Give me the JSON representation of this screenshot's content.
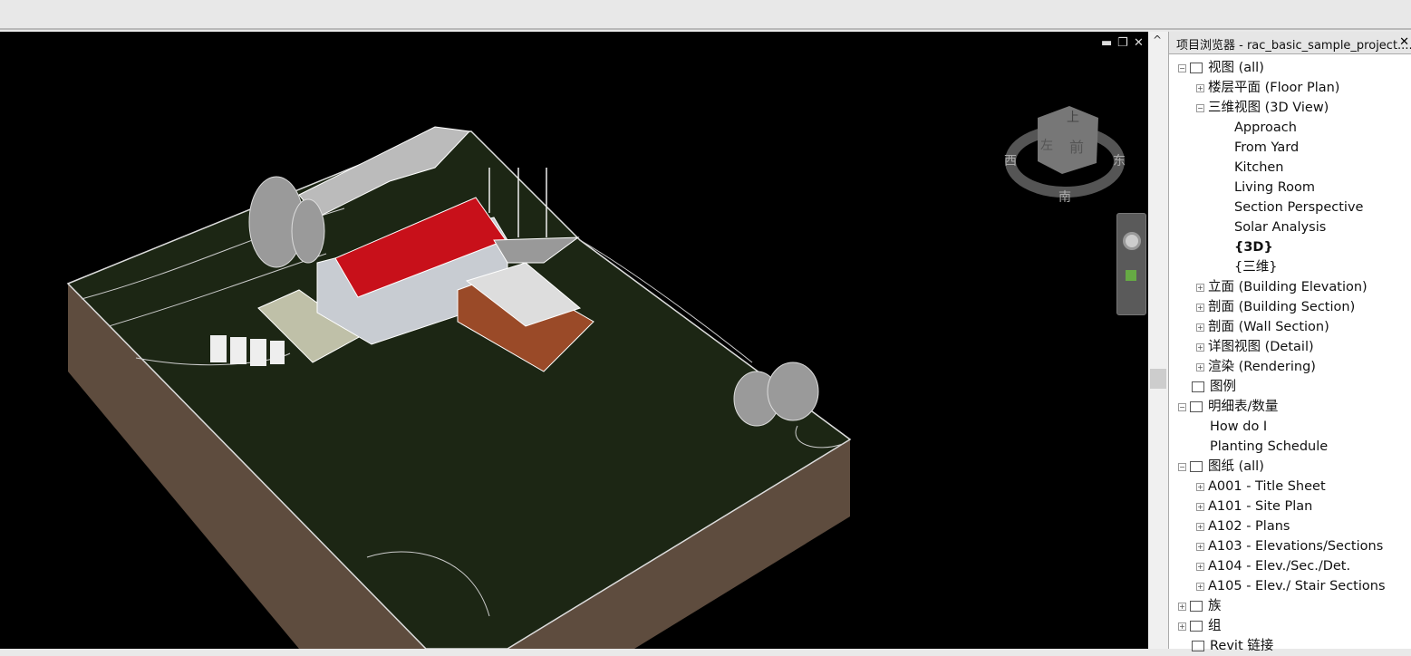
{
  "window_controls": {
    "minimize": "▬",
    "restore": "❐",
    "close": "✕"
  },
  "viewcube": {
    "top": "上",
    "left": "左",
    "front": "前",
    "compass": {
      "west": "西",
      "east": "东",
      "south": "南"
    }
  },
  "browser": {
    "title": "项目浏览器 - rac_basic_sample_project....",
    "close": "✕",
    "items": [
      {
        "label": "视图 (all)",
        "level": 0,
        "toggle": "−",
        "icon": "views-icon"
      },
      {
        "label": "楼层平面 (Floor Plan)",
        "level": 1,
        "toggle": "+"
      },
      {
        "label": "三维视图 (3D View)",
        "level": 1,
        "toggle": "−"
      },
      {
        "label": "Approach",
        "level": 2
      },
      {
        "label": "From Yard",
        "level": 2
      },
      {
        "label": "Kitchen",
        "level": 2
      },
      {
        "label": "Living Room",
        "level": 2
      },
      {
        "label": "Section Perspective",
        "level": 2
      },
      {
        "label": "Solar Analysis",
        "level": 2
      },
      {
        "label": "{3D}",
        "level": 2,
        "selected": true
      },
      {
        "label": "{三维}",
        "level": 2
      },
      {
        "label": "立面 (Building Elevation)",
        "level": 1,
        "toggle": "+"
      },
      {
        "label": "剖面 (Building Section)",
        "level": 1,
        "toggle": "+"
      },
      {
        "label": "剖面 (Wall Section)",
        "level": 1,
        "toggle": "+"
      },
      {
        "label": "详图视图 (Detail)",
        "level": 1,
        "toggle": "+"
      },
      {
        "label": "渲染 (Rendering)",
        "level": 1,
        "toggle": "+"
      },
      {
        "label": "图例",
        "level": 0,
        "icon": "legend-icon"
      },
      {
        "label": "明细表/数量",
        "level": 0,
        "toggle": "−",
        "icon": "schedule-icon"
      },
      {
        "label": "How do I",
        "level": 1
      },
      {
        "label": "Planting Schedule",
        "level": 1
      },
      {
        "label": "图纸 (all)",
        "level": 0,
        "toggle": "−",
        "icon": "sheets-icon"
      },
      {
        "label": "A001 - Title Sheet",
        "level": 1,
        "toggle": "+"
      },
      {
        "label": "A101 - Site Plan",
        "level": 1,
        "toggle": "+"
      },
      {
        "label": "A102 - Plans",
        "level": 1,
        "toggle": "+"
      },
      {
        "label": "A103 - Elevations/Sections",
        "level": 1,
        "toggle": "+"
      },
      {
        "label": "A104 - Elev./Sec./Det.",
        "level": 1,
        "toggle": "+"
      },
      {
        "label": "A105 - Elev./ Stair Sections",
        "level": 1,
        "toggle": "+"
      },
      {
        "label": "族",
        "level": 0,
        "toggle": "+",
        "icon": "families-icon"
      },
      {
        "label": "组",
        "level": 0,
        "toggle": "+",
        "icon": "groups-icon"
      },
      {
        "label": "Revit 链接",
        "level": 0,
        "icon": "revit-links-icon"
      }
    ]
  },
  "colors": {
    "terrain_top": "#1c2614",
    "terrain_side": "#5e4c3e",
    "roof": "#c8101a",
    "background": "#000000"
  }
}
